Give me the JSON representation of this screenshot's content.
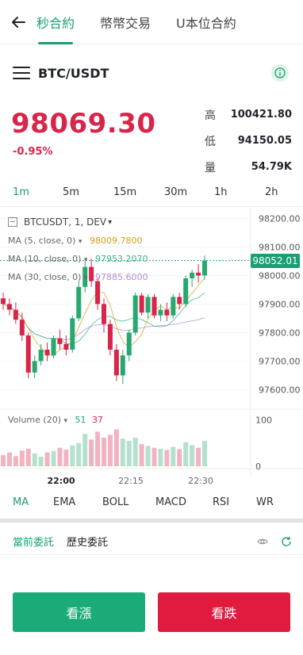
{
  "nav": {
    "tabs": [
      {
        "label": "秒合約",
        "active": true
      },
      {
        "label": "幣幣交易",
        "active": false
      },
      {
        "label": "U本位合約",
        "active": false
      }
    ]
  },
  "pair": {
    "symbol": "BTC/USDT"
  },
  "ticker": {
    "price": "98069.30",
    "change": "-0.95%",
    "stats": [
      {
        "label": "高",
        "value": "100421.80"
      },
      {
        "label": "低",
        "value": "94150.05"
      },
      {
        "label": "量",
        "value": "54.79K"
      }
    ]
  },
  "timeframes": [
    {
      "label": "1m",
      "active": true
    },
    {
      "label": "5m",
      "active": false
    },
    {
      "label": "15m",
      "active": false
    },
    {
      "label": "30m",
      "active": false
    },
    {
      "label": "1h",
      "active": false
    },
    {
      "label": "2h",
      "active": false
    }
  ],
  "chart": {
    "symbol_label": "BTCUSDT, 1, DEV",
    "ma5": {
      "label": "MA (5, close, 0)",
      "value": "98009.7800",
      "color": "#d4a017"
    },
    "ma10": {
      "label": "MA (10, close, 0)",
      "value": "97953.2070",
      "color": "#35b48c"
    },
    "ma30": {
      "label": "MA (30, close, 0)",
      "value": "97885.6000",
      "color": "#b48ad6"
    },
    "last_price": "98052.01",
    "volume": {
      "label": "Volume (20)",
      "up": "51",
      "down": "37"
    },
    "up_color": "#26a86f",
    "down_color": "#d8254a"
  },
  "chart_data": {
    "type": "candlestick",
    "price_axis": [
      "98200.00",
      "98100.00",
      "98000.00",
      "97900.00",
      "97800.00",
      "97700.00",
      "97600.00"
    ],
    "price_ticks": [
      98200,
      98100,
      98000,
      97900,
      97800,
      97700,
      97600
    ],
    "volume_axis": [
      "100",
      "0"
    ],
    "volume_ticks": [
      100,
      0
    ],
    "time_axis": [
      {
        "label": "22:00",
        "bold": true
      },
      {
        "label": "22:15",
        "bold": false
      },
      {
        "label": "22:30",
        "bold": false
      }
    ],
    "ylim": [
      97540,
      98240
    ],
    "vlim": [
      0,
      115
    ],
    "candles": [
      {
        "o": 97920,
        "h": 97940,
        "l": 97880,
        "c": 97900,
        "v": 24
      },
      {
        "o": 97900,
        "h": 97920,
        "l": 97860,
        "c": 97880,
        "v": 30
      },
      {
        "o": 97880,
        "h": 97905,
        "l": 97830,
        "c": 97845,
        "v": 22
      },
      {
        "o": 97845,
        "h": 97870,
        "l": 97770,
        "c": 97790,
        "v": 34
      },
      {
        "o": 97790,
        "h": 97800,
        "l": 97640,
        "c": 97660,
        "v": 38
      },
      {
        "o": 97660,
        "h": 97720,
        "l": 97640,
        "c": 97700,
        "v": 28
      },
      {
        "o": 97700,
        "h": 97760,
        "l": 97685,
        "c": 97740,
        "v": 21
      },
      {
        "o": 97740,
        "h": 97765,
        "l": 97700,
        "c": 97720,
        "v": 30
      },
      {
        "o": 97720,
        "h": 97790,
        "l": 97710,
        "c": 97780,
        "v": 33
      },
      {
        "o": 97780,
        "h": 97810,
        "l": 97740,
        "c": 97760,
        "v": 40
      },
      {
        "o": 97760,
        "h": 97790,
        "l": 97720,
        "c": 97740,
        "v": 36
      },
      {
        "o": 97740,
        "h": 97860,
        "l": 97730,
        "c": 97850,
        "v": 45
      },
      {
        "o": 97850,
        "h": 97980,
        "l": 97840,
        "c": 97960,
        "v": 50
      },
      {
        "o": 97960,
        "h": 98050,
        "l": 97940,
        "c": 98030,
        "v": 70
      },
      {
        "o": 98030,
        "h": 98060,
        "l": 97960,
        "c": 97980,
        "v": 58
      },
      {
        "o": 97980,
        "h": 97990,
        "l": 97880,
        "c": 97900,
        "v": 75
      },
      {
        "o": 97900,
        "h": 97920,
        "l": 97800,
        "c": 97830,
        "v": 62
      },
      {
        "o": 97830,
        "h": 97845,
        "l": 97720,
        "c": 97740,
        "v": 68
      },
      {
        "o": 97740,
        "h": 97760,
        "l": 97630,
        "c": 97650,
        "v": 80
      },
      {
        "o": 97650,
        "h": 97740,
        "l": 97620,
        "c": 97720,
        "v": 60
      },
      {
        "o": 97720,
        "h": 97810,
        "l": 97700,
        "c": 97800,
        "v": 55
      },
      {
        "o": 97800,
        "h": 97940,
        "l": 97790,
        "c": 97930,
        "v": 62
      },
      {
        "o": 97930,
        "h": 97940,
        "l": 97860,
        "c": 97870,
        "v": 48
      },
      {
        "o": 97870,
        "h": 97935,
        "l": 97850,
        "c": 97925,
        "v": 44
      },
      {
        "o": 97925,
        "h": 97935,
        "l": 97850,
        "c": 97860,
        "v": 40
      },
      {
        "o": 97860,
        "h": 97900,
        "l": 97840,
        "c": 97880,
        "v": 38
      },
      {
        "o": 97880,
        "h": 97905,
        "l": 97840,
        "c": 97860,
        "v": 35
      },
      {
        "o": 97860,
        "h": 97935,
        "l": 97850,
        "c": 97925,
        "v": 42
      },
      {
        "o": 97925,
        "h": 97940,
        "l": 97880,
        "c": 97900,
        "v": 37
      },
      {
        "o": 97900,
        "h": 98000,
        "l": 97890,
        "c": 97990,
        "v": 52
      },
      {
        "o": 97990,
        "h": 98020,
        "l": 97960,
        "c": 98010,
        "v": 46
      },
      {
        "o": 98010,
        "h": 98040,
        "l": 97975,
        "c": 98000,
        "v": 40
      },
      {
        "o": 98000,
        "h": 98070,
        "l": 97985,
        "c": 98052,
        "v": 55
      }
    ]
  },
  "indicators": [
    {
      "label": "MA",
      "active": true
    },
    {
      "label": "EMA",
      "active": false
    },
    {
      "label": "BOLL",
      "active": false
    },
    {
      "label": "MACD",
      "active": false
    },
    {
      "label": "RSI",
      "active": false
    },
    {
      "label": "WR",
      "active": false
    }
  ],
  "orders": {
    "current": "當前委託",
    "history": "歷史委託"
  },
  "actions": {
    "buy": "看漲",
    "sell": "看跌"
  }
}
